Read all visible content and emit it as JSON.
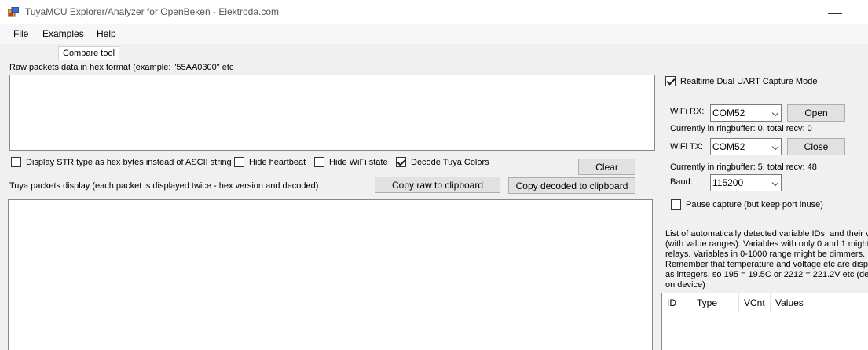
{
  "window": {
    "title": "TuyaMCU Explorer/Analyzer for OpenBeken - Elektroda.com",
    "close_glyph": "—"
  },
  "menu": {
    "items": [
      "File",
      "Examples",
      "Help"
    ]
  },
  "tabs": [
    "Compare tool"
  ],
  "raw_packets": {
    "label": "Raw packets data in hex format (example: \"55AA0300\" etc",
    "value": ""
  },
  "options": {
    "display_str_hex": {
      "label": "Display STR type as hex bytes instead of ASCII string",
      "checked": false
    },
    "hide_heartbeat": {
      "label": "Hide heartbeat",
      "checked": false
    },
    "hide_wifi_state": {
      "label": "Hide WiFi state",
      "checked": false
    },
    "decode_colors": {
      "label": "Decode Tuya Colors",
      "checked": true
    }
  },
  "buttons": {
    "clear": "Clear",
    "copy_raw": "Copy raw to clipboard",
    "copy_decoded": "Copy decoded to clipboard",
    "open": "Open",
    "close": "Close"
  },
  "tuya_display": {
    "label": "Tuya packets display (each packet is displayed twice - hex version and decoded)",
    "value": ""
  },
  "capture": {
    "realtime_label": "Realtime Dual UART Capture Mode",
    "realtime_checked": true,
    "wifi_rx_label": "WiFi RX:",
    "wifi_rx_port": "COM52",
    "rx_status": "Currently in ringbuffer: 0, total recv: 0",
    "wifi_tx_label": "WiFi TX:",
    "wifi_tx_port": "COM52",
    "tx_status": "Currently in ringbuffer: 5, total recv: 48",
    "baud_label": "Baud:",
    "baud_value": "115200",
    "pause_label": "Pause capture (but keep port inuse)",
    "pause_checked": false
  },
  "variables": {
    "description": "List of automatically detected variable IDs  and their values\n(with value ranges). Variables with only 0 and 1 might be\nrelays. Variables in 0-1000 range might be dimmers.\nRemember that temperature and voltage etc are displayed\nas integers, so 195 = 19.5C or 2212 = 221.2V etc (depends\non device)",
    "columns": [
      "ID",
      "Type",
      "VCnt",
      "Values"
    ]
  }
}
